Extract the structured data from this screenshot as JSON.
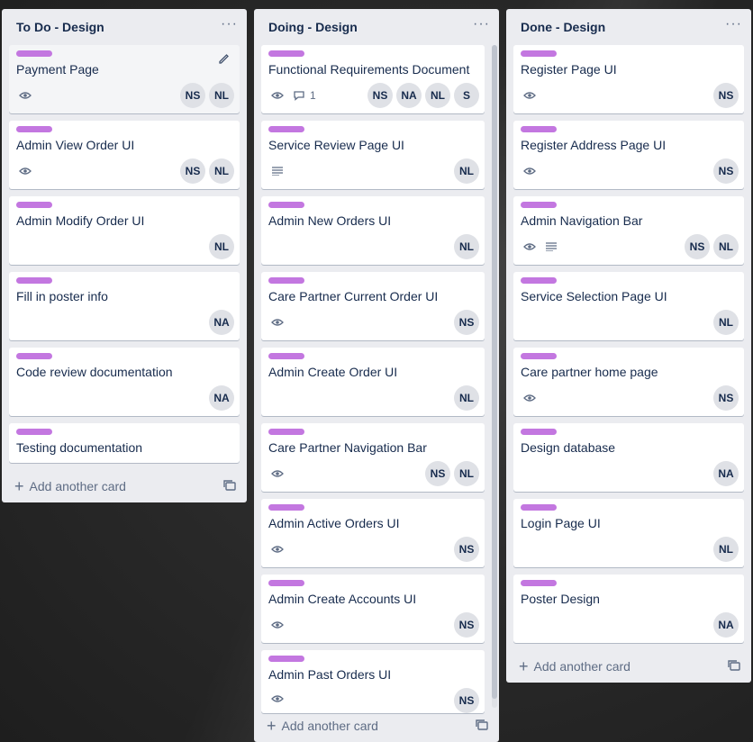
{
  "colors": {
    "label": "#c377e0",
    "list_bg": "#ebecf0",
    "avatar_bg": "#dfe1e6"
  },
  "add_card_label": "Add another card",
  "lists": [
    {
      "title": "To Do - Design",
      "cards": [
        {
          "title": "Payment Page",
          "watch": true,
          "members": [
            "NS",
            "NL"
          ]
        },
        {
          "title": "Admin View Order UI",
          "watch": true,
          "members": [
            "NS",
            "NL"
          ]
        },
        {
          "title": "Admin Modify Order UI",
          "members": [
            "NL"
          ]
        },
        {
          "title": "Fill in poster info",
          "members": [
            "NA"
          ]
        },
        {
          "title": "Code review documentation",
          "members": [
            "NA"
          ]
        },
        {
          "title": "Testing documentation",
          "members": []
        }
      ]
    },
    {
      "title": "Doing - Design",
      "cards": [
        {
          "title": "Functional Requirements Document",
          "watch": true,
          "comments": "1",
          "members": [
            "NS",
            "NA",
            "NL",
            "S"
          ]
        },
        {
          "title": "Service Review Page UI",
          "description": true,
          "members": [
            "NL"
          ]
        },
        {
          "title": "Admin New Orders UI",
          "members": [
            "NL"
          ]
        },
        {
          "title": "Care Partner Current Order UI",
          "watch": true,
          "members": [
            "NS"
          ]
        },
        {
          "title": "Admin Create Order UI",
          "members": [
            "NL"
          ]
        },
        {
          "title": "Care Partner Navigation Bar",
          "watch": true,
          "members": [
            "NS",
            "NL"
          ]
        },
        {
          "title": "Admin Active Orders UI",
          "watch": true,
          "members": [
            "NS"
          ]
        },
        {
          "title": "Admin Create Accounts UI",
          "watch": true,
          "members": [
            "NS"
          ]
        },
        {
          "title": "Admin Past Orders UI",
          "watch": true,
          "members": [
            "NS"
          ]
        }
      ]
    },
    {
      "title": "Done - Design",
      "cards": [
        {
          "title": "Register Page UI",
          "watch": true,
          "members": [
            "NS"
          ]
        },
        {
          "title": "Register Address Page UI",
          "watch": true,
          "members": [
            "NS"
          ]
        },
        {
          "title": "Admin Navigation Bar",
          "watch": true,
          "description": true,
          "members": [
            "NS",
            "NL"
          ]
        },
        {
          "title": "Service Selection Page UI",
          "members": [
            "NL"
          ]
        },
        {
          "title": "Care partner home page",
          "watch": true,
          "members": [
            "NS"
          ]
        },
        {
          "title": "Design database",
          "members": [
            "NA"
          ]
        },
        {
          "title": "Login Page UI",
          "members": [
            "NL"
          ]
        },
        {
          "title": "Poster Design",
          "members": [
            "NA"
          ]
        }
      ]
    }
  ]
}
